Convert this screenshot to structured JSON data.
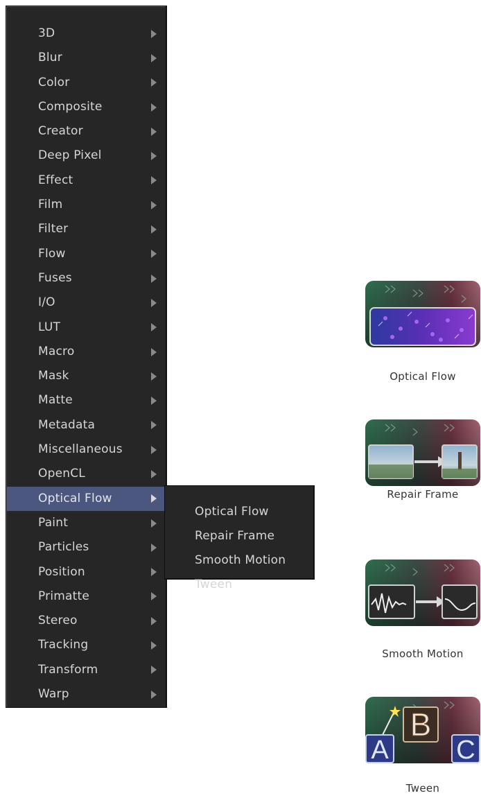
{
  "menu": {
    "items": [
      {
        "label": "3D"
      },
      {
        "label": "Blur"
      },
      {
        "label": "Color"
      },
      {
        "label": "Composite"
      },
      {
        "label": "Creator"
      },
      {
        "label": "Deep Pixel"
      },
      {
        "label": "Effect"
      },
      {
        "label": "Film"
      },
      {
        "label": "Filter"
      },
      {
        "label": "Flow"
      },
      {
        "label": "Fuses"
      },
      {
        "label": "I/O"
      },
      {
        "label": "LUT"
      },
      {
        "label": "Macro"
      },
      {
        "label": "Mask"
      },
      {
        "label": "Matte"
      },
      {
        "label": "Metadata"
      },
      {
        "label": "Miscellaneous"
      },
      {
        "label": "OpenCL"
      },
      {
        "label": "Optical Flow",
        "highlighted": true
      },
      {
        "label": "Paint"
      },
      {
        "label": "Particles"
      },
      {
        "label": "Position"
      },
      {
        "label": "Primatte"
      },
      {
        "label": "Stereo"
      },
      {
        "label": "Tracking"
      },
      {
        "label": "Transform"
      },
      {
        "label": "Warp"
      }
    ]
  },
  "submenu": {
    "items": [
      {
        "label": "Optical Flow"
      },
      {
        "label": "Repair Frame"
      },
      {
        "label": "Smooth Motion"
      },
      {
        "label": "Tween"
      }
    ]
  },
  "tools": [
    {
      "label": "Optical Flow",
      "icon": "optical-flow-icon"
    },
    {
      "label": "Repair Frame",
      "icon": "repair-frame-icon"
    },
    {
      "label": "Smooth Motion",
      "icon": "smooth-motion-icon"
    },
    {
      "label": "Tween",
      "icon": "tween-icon"
    }
  ],
  "colors": {
    "menu_background": "#262626",
    "highlight": "#4c5780",
    "menu_text": "#d6d6d6"
  }
}
